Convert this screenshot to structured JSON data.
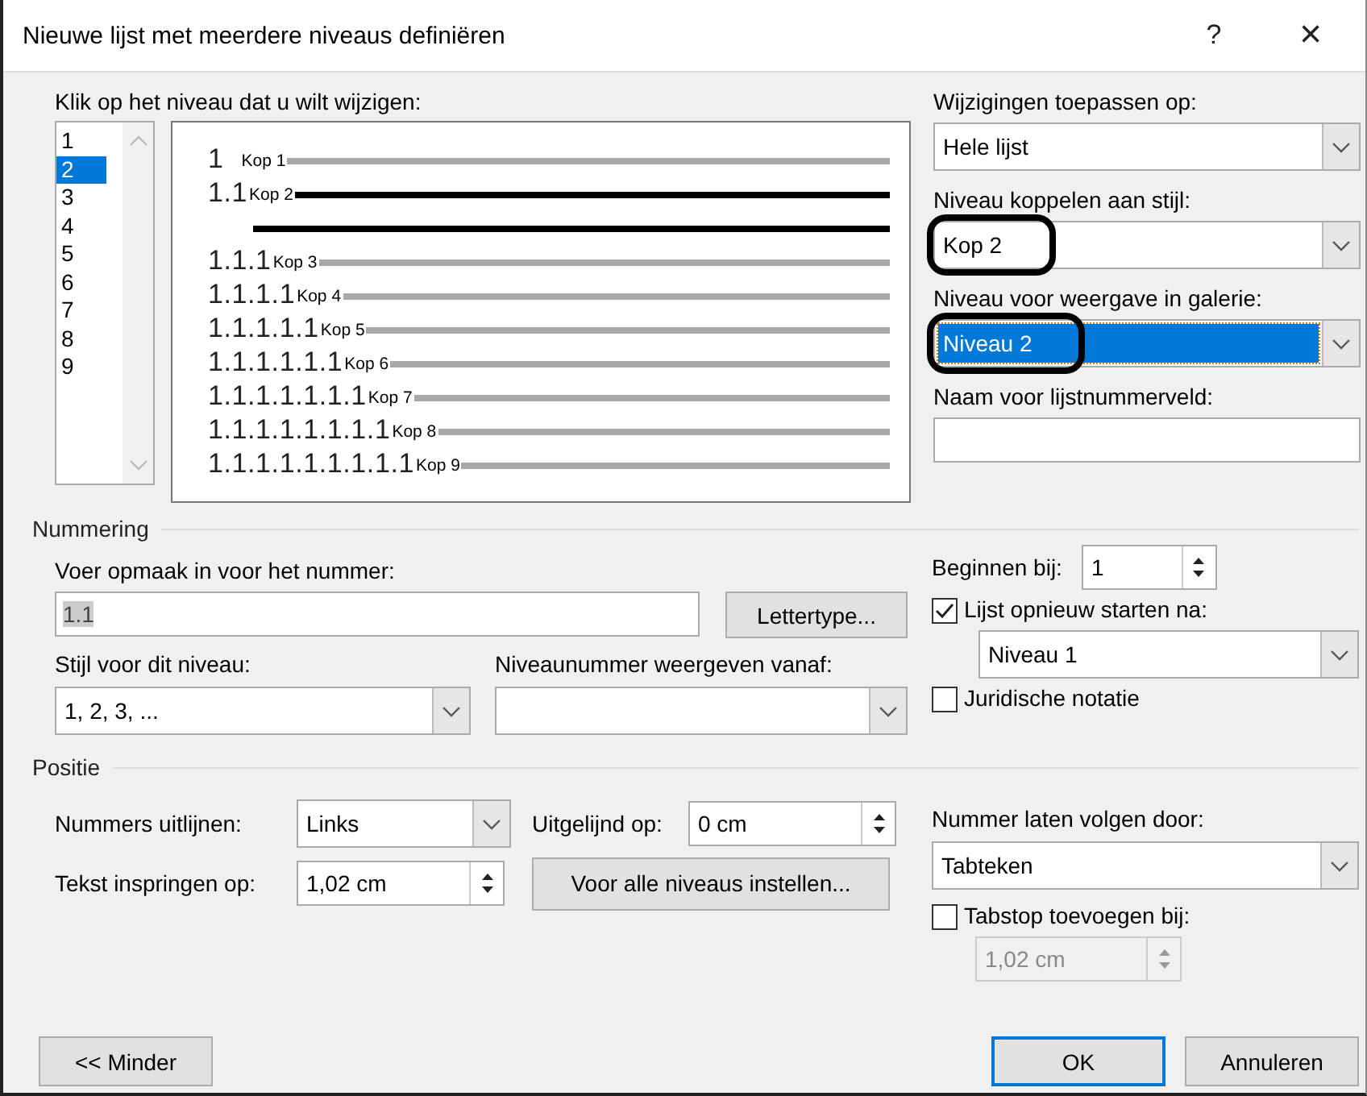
{
  "window": {
    "title": "Nieuwe lijst met meerdere niveaus definiëren",
    "help": "?",
    "close": "×"
  },
  "level_picker": {
    "label": "Klik op het niveau dat u wilt wijzigen:",
    "levels": [
      {
        "label": "1",
        "selected": false
      },
      {
        "label": "2",
        "selected": true
      },
      {
        "label": "3",
        "selected": false
      },
      {
        "label": "4",
        "selected": false
      },
      {
        "label": "5",
        "selected": false
      },
      {
        "label": "6",
        "selected": false
      },
      {
        "label": "7",
        "selected": false
      },
      {
        "label": "8",
        "selected": false
      },
      {
        "label": "9",
        "selected": false
      }
    ]
  },
  "preview": [
    {
      "number": "1",
      "style": "Kop 1",
      "selected": false
    },
    {
      "number": "1.1",
      "style": "Kop 2",
      "selected": true
    },
    {
      "number": "1.1.1",
      "style": "Kop 3",
      "selected": false
    },
    {
      "number": "1.1.1.1",
      "style": "Kop 4",
      "selected": false
    },
    {
      "number": "1.1.1.1.1",
      "style": "Kop 5",
      "selected": false
    },
    {
      "number": "1.1.1.1.1.1",
      "style": "Kop 6",
      "selected": false
    },
    {
      "number": "1.1.1.1.1.1.1",
      "style": "Kop 7",
      "selected": false
    },
    {
      "number": "1.1.1.1.1.1.1.1",
      "style": "Kop 8",
      "selected": false
    },
    {
      "number": "1.1.1.1.1.1.1.1.1",
      "style": "Kop 9",
      "selected": false
    }
  ],
  "right_fields": [
    {
      "kind": "dropdown",
      "label": "Wijzigingen toepassen op:",
      "value": "Hele lijst",
      "highlighted": false,
      "circled": false
    },
    {
      "kind": "dropdown",
      "label": "Niveau koppelen aan stijl:",
      "value": "Kop 2",
      "highlighted": false,
      "circled": true
    },
    {
      "kind": "dropdown",
      "label": "Niveau voor weergave in galerie:",
      "value": "Niveau 2",
      "highlighted": true,
      "circled": true
    },
    {
      "kind": "text",
      "label": "Naam voor lijstnummerveld:"
    }
  ],
  "numbering": {
    "heading": "Nummering",
    "format_label": "Voer opmaak in voor het nummer:",
    "format_value": "1.1",
    "font_button": "Lettertype...",
    "style_label": "Stijl voor dit niveau:",
    "style_value": "1, 2, 3, ...",
    "from_label": "Niveaunummer weergeven vanaf:",
    "start_label": "Beginnen bij:",
    "start_value": "1",
    "restart": {
      "label": "Lijst opnieuw starten na:",
      "checked": true
    },
    "restart_value": "Niveau 1",
    "legal": {
      "label": "Juridische notatie",
      "checked": false
    }
  },
  "position": {
    "heading": "Positie",
    "align_label": "Nummers uitlijnen:",
    "align_value": "Links",
    "aligned_at_label": "Uitgelijnd op:",
    "aligned_at_value": "0 cm",
    "indent_label": "Tekst inspringen op:",
    "indent_value": "1,02 cm",
    "all_levels_button": "Voor alle niveaus instellen...",
    "follow_label": "Nummer laten volgen door:",
    "follow_value": "Tabteken",
    "tabstop": {
      "label": "Tabstop toevoegen bij:",
      "checked": false
    },
    "tabstop_value": "1,02 cm",
    "tabstop_disabled": true
  },
  "buttons": {
    "less": "<< Minder",
    "ok": "OK",
    "cancel": "Annuleren"
  }
}
